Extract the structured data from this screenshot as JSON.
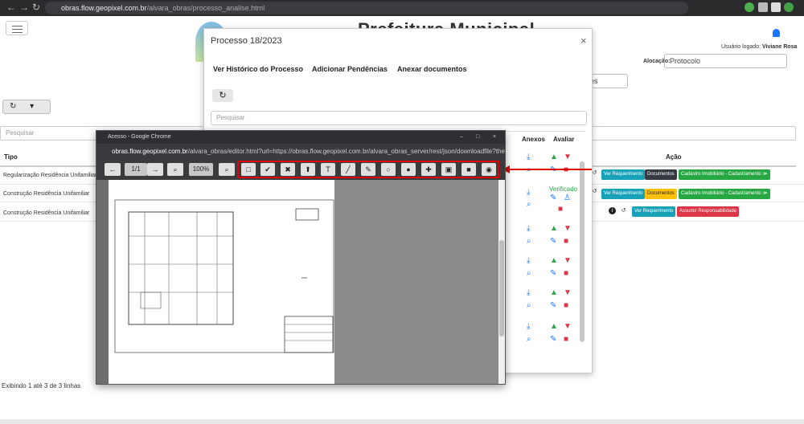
{
  "browser": {
    "url_host": "obras.flow.geopixel.com.br",
    "url_path": "/alvara_obras/processo_analise.html"
  },
  "page": {
    "title": "Prefeitura Municipal",
    "user_label": "Usuário logado:",
    "user_name": "Viviane Rosa",
    "alocacao_label": "Alocação:",
    "alocacao_value": "Protocolo",
    "filter_value": "es",
    "search_placeholder": "Pesquisar",
    "col_tipo": "Tipo",
    "col_acao": "Ação",
    "rows": [
      {
        "tipo": "Regularização Residência Unifamiliar"
      },
      {
        "tipo": "Construção Residência Unifamiliar"
      },
      {
        "tipo": "Construção Residência Unifamiliar"
      }
    ],
    "btn_ver_requerimento": "Ver Requerimento",
    "btn_documentos": "Documentos",
    "btn_cadastro": "Cadastro Imobiliário - Cadastramento ≫",
    "btn_assumir": "Assumir Responsabilidade",
    "footer": "Exibindo 1 até 3 de 3 linhas"
  },
  "modal": {
    "title": "Processo 18/2023",
    "close": "×",
    "tabs": [
      "Ver Histórico do Processo",
      "Adicionar Pendências",
      "Anexar documentos"
    ],
    "search_placeholder": "Pesquisar",
    "col_anexos": "Anexos",
    "col_avaliar": "Avaliar",
    "verified": "Verificado"
  },
  "popup": {
    "window_title": "Acesso - Google Chrome",
    "url_host": "obras.flow.geopixel.com.br",
    "url_path": "/alvara_obras/editor.html?url=https://obras.flow.geopixel.com.br/alvara_obras_server/rest/json/downloadfile?themel...",
    "page_indicator": "1/1",
    "zoom_value": "100%",
    "tools": [
      "rectangle-tool",
      "check-tool",
      "cross-tool",
      "arrow-up-tool",
      "text-tool",
      "line-tool",
      "edit-tool",
      "circle-tool",
      "dot-tool",
      "plus-tool",
      "save-tool",
      "stop-tool",
      "view-tool"
    ]
  },
  "icons": {
    "back": "←",
    "forward": "→",
    "reload": "↻",
    "refresh": "↻",
    "caret": "▾",
    "download": "⤓",
    "zoom": "🔍",
    "thumbs_up": "👍",
    "thumbs_down": "👎",
    "edit": "✎",
    "trash": "🗑",
    "history": "🕘",
    "info": "i",
    "bell": "bell"
  },
  "colors": {
    "accent_red": "#e00000",
    "blue": "#17a2b8",
    "green": "#28a745"
  }
}
